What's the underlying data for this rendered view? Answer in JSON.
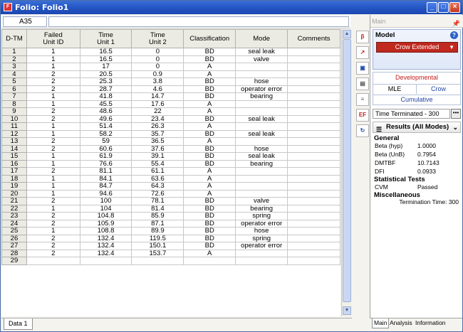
{
  "window": {
    "title": "Folio: Folio1"
  },
  "cell_ref": "A35",
  "columns": [
    "D-TM",
    "Failed\nUnit ID",
    "Time\nUnit 1",
    "Time\nUnit 2",
    "Classification",
    "Mode",
    "Comments"
  ],
  "rows": [
    [
      "1",
      "1",
      "16.5",
      "0",
      "BD",
      "seal leak",
      ""
    ],
    [
      "2",
      "1",
      "16.5",
      "0",
      "BD",
      "valve",
      ""
    ],
    [
      "3",
      "1",
      "17",
      "0",
      "A",
      "",
      ""
    ],
    [
      "4",
      "2",
      "20.5",
      "0.9",
      "A",
      "",
      ""
    ],
    [
      "5",
      "2",
      "25.3",
      "3.8",
      "BD",
      "hose",
      ""
    ],
    [
      "6",
      "2",
      "28.7",
      "4.6",
      "BD",
      "operator error",
      ""
    ],
    [
      "7",
      "1",
      "41.8",
      "14.7",
      "BD",
      "bearing",
      ""
    ],
    [
      "8",
      "1",
      "45.5",
      "17.6",
      "A",
      "",
      ""
    ],
    [
      "9",
      "2",
      "48.6",
      "22",
      "A",
      "",
      ""
    ],
    [
      "10",
      "2",
      "49.6",
      "23.4",
      "BD",
      "seal leak",
      ""
    ],
    [
      "11",
      "1",
      "51.4",
      "26.3",
      "A",
      "",
      ""
    ],
    [
      "12",
      "1",
      "58.2",
      "35.7",
      "BD",
      "seal leak",
      ""
    ],
    [
      "13",
      "2",
      "59",
      "36.5",
      "A",
      "",
      ""
    ],
    [
      "14",
      "2",
      "60.6",
      "37.6",
      "BD",
      "hose",
      ""
    ],
    [
      "15",
      "1",
      "61.9",
      "39.1",
      "BD",
      "seal leak",
      ""
    ],
    [
      "16",
      "1",
      "76.6",
      "55.4",
      "BD",
      "bearing",
      ""
    ],
    [
      "17",
      "2",
      "81.1",
      "61.1",
      "A",
      "",
      ""
    ],
    [
      "18",
      "1",
      "84.1",
      "63.6",
      "A",
      "",
      ""
    ],
    [
      "19",
      "1",
      "84.7",
      "64.3",
      "A",
      "",
      ""
    ],
    [
      "20",
      "1",
      "94.6",
      "72.6",
      "A",
      "",
      ""
    ],
    [
      "21",
      "2",
      "100",
      "78.1",
      "BD",
      "valve",
      ""
    ],
    [
      "22",
      "1",
      "104",
      "81.4",
      "BD",
      "bearing",
      ""
    ],
    [
      "23",
      "2",
      "104.8",
      "85.9",
      "BD",
      "spring",
      ""
    ],
    [
      "24",
      "2",
      "105.9",
      "87.1",
      "BD",
      "operator error",
      ""
    ],
    [
      "25",
      "1",
      "108.8",
      "89.9",
      "BD",
      "hose",
      ""
    ],
    [
      "26",
      "2",
      "132.4",
      "119.5",
      "BD",
      "spring",
      ""
    ],
    [
      "27",
      "2",
      "132.4",
      "150.1",
      "BD",
      "operator error",
      ""
    ],
    [
      "28",
      "2",
      "132.4",
      "153.7",
      "A",
      "",
      ""
    ],
    [
      "29",
      "",
      "",
      "",
      "",
      "",
      ""
    ]
  ],
  "sheet_tab": "Data 1",
  "panel": {
    "header": "Main",
    "model_label": "Model",
    "model_value": "Crow Extended",
    "options": {
      "developmental": "Developmental",
      "mle": "MLE",
      "crow": "Crow",
      "cumulative": "Cumulative"
    },
    "termination": "Time Terminated - 300",
    "results_title": "Results (All Modes)",
    "general_label": "General",
    "general": [
      {
        "k": "Beta (hyp)",
        "v": "1.0000"
      },
      {
        "k": "Beta (UnB)",
        "v": "0.7954"
      },
      {
        "k": "DMTBF",
        "v": "10.7143"
      },
      {
        "k": "DFI",
        "v": "0.0933"
      }
    ],
    "stat_label": "Statistical Tests",
    "stat": [
      {
        "k": "CVM",
        "v": "Passed"
      }
    ],
    "misc_label": "Miscellaneous",
    "misc_term": "Termination Time: 300",
    "tabs": [
      "Main",
      "Analysis",
      "Information"
    ]
  },
  "tools": [
    "β",
    "↗",
    "▣",
    "▤",
    "≡",
    "EF",
    "↻"
  ]
}
